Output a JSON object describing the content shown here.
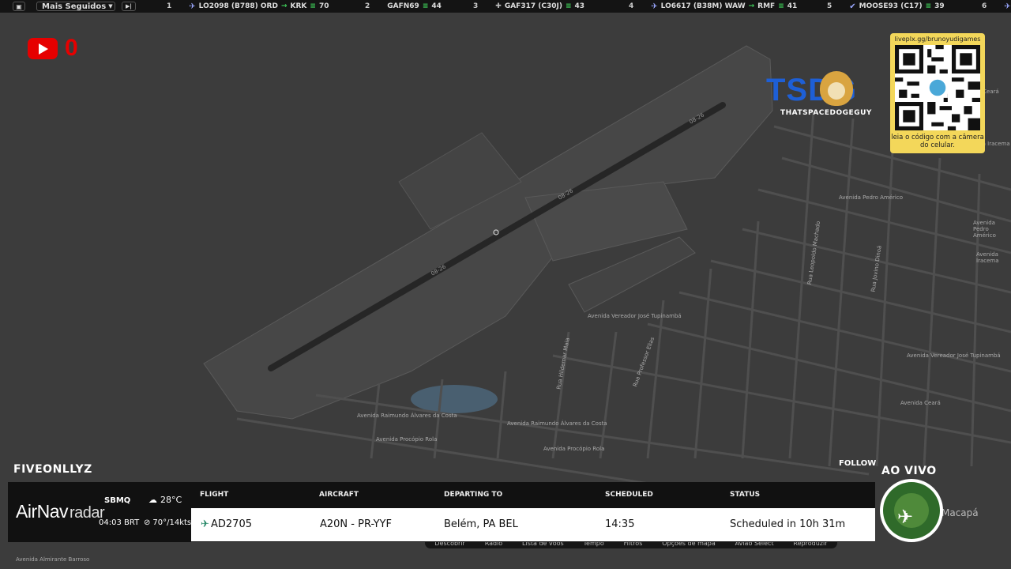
{
  "topbar": {
    "mode_label": "Mais Seguidos",
    "items": [
      {
        "rank": "1",
        "flight": "LO2098 (B788) ORD",
        "dest": "KRK",
        "count": "70"
      },
      {
        "rank": "2",
        "flight": "GAFN69",
        "dest": "",
        "count": "44"
      },
      {
        "rank": "3",
        "flight": "GAF317 (C30J)",
        "dest": "",
        "count": "43"
      },
      {
        "rank": "4",
        "flight": "LO6617 (B38M) WAW",
        "dest": "RMF",
        "count": "41"
      },
      {
        "rank": "5",
        "flight": "MOOSE93 (C17)",
        "dest": "",
        "count": "39"
      },
      {
        "rank": "6",
        "flight": "",
        "dest": "",
        "count": ""
      }
    ]
  },
  "youtube": {
    "count": "0"
  },
  "branding": {
    "name": "TSDG",
    "sub": "THATSPACEDOGEGUY"
  },
  "qr": {
    "url": "liveplx.gg/brunoyudigames",
    "note": "leia o código com a câmera do celular."
  },
  "overlay": {
    "username": "FIVEONLLYZ",
    "follow": "FOLLOW",
    "live": "AO VIVO"
  },
  "map": {
    "runway_labels": [
      "08-26",
      "08-26",
      "08-26"
    ],
    "streets": [
      "Avenida Pedro Américo",
      "Avenida Vereador José Tupinambá",
      "Avenida Raimundo Álvares da Costa",
      "Avenida Raimundo Álvares da Costa",
      "Avenida Procópio Rola",
      "Avenida Procópio Rola",
      "Rua Professor Elias",
      "Rua Hildemar Maia",
      "Avenida Almirante Barroso",
      "Rua Leopoldo Machado",
      "Rua Jovino Dinoá",
      "Avenida Iracema",
      "Avenida Ceará",
      "Avenida Vereador José Tupinambá",
      "Avenida Ceará",
      "Avenida Pedro Américo",
      "Avenida Iracema",
      "Macapá"
    ]
  },
  "airnav": {
    "logo_main": "AirNav",
    "logo_sub": "radar",
    "station": "SBMQ",
    "local_time": "04:03 BRT",
    "temperature": "28°C",
    "wind": "70°/14kts",
    "headers": {
      "flight": "FLIGHT",
      "aircraft": "AIRCRAFT",
      "departing": "DEPARTING TO",
      "scheduled": "SCHEDULED",
      "status": "STATUS"
    },
    "row": {
      "flight": "AD2705",
      "aircraft": "A20N - PR-YYF",
      "departing": "Belém, PA BEL",
      "scheduled": "14:35",
      "status": "Scheduled in 10h 31m"
    },
    "menu": [
      "Descobrir",
      "Rádio",
      "Lista de voos",
      "Tempo",
      "Filtros",
      "Opções de mapa",
      "Avião Select",
      "Reproduzir"
    ]
  }
}
